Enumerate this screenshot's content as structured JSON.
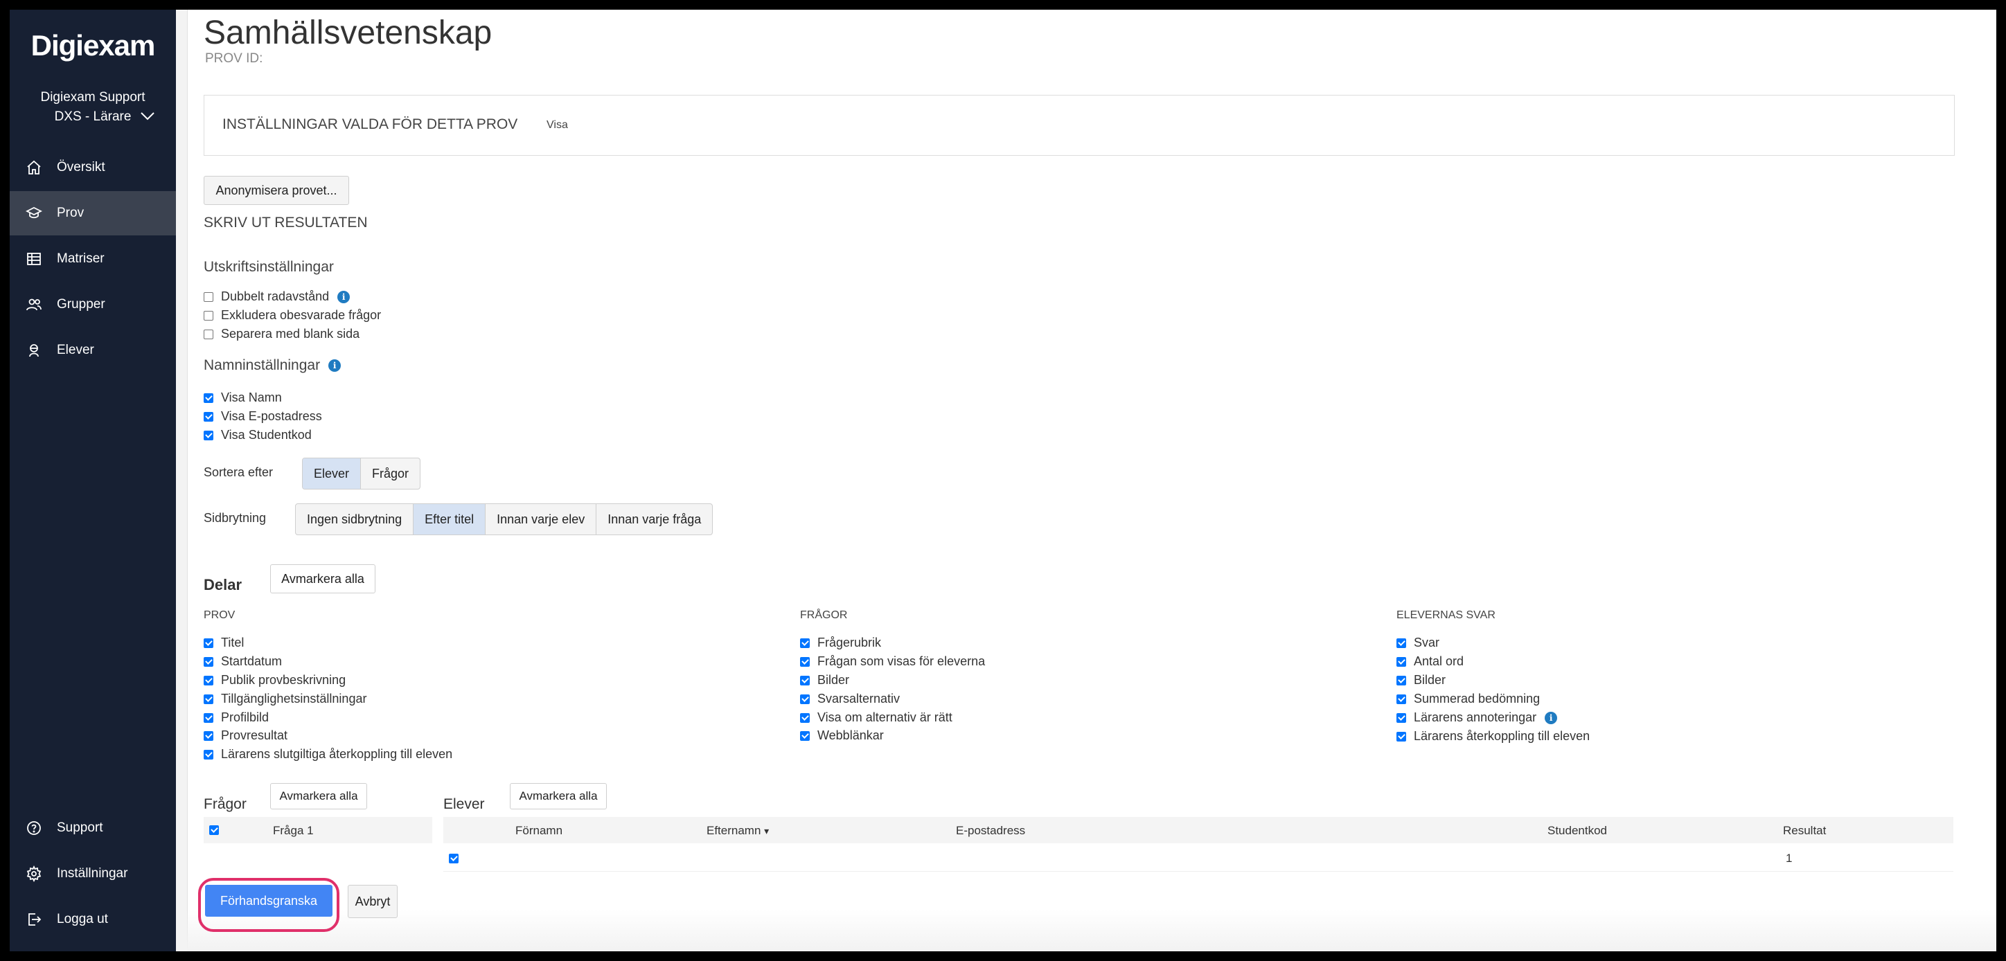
{
  "sidebar": {
    "logo": "Digiexam",
    "org_name": "Digiexam Support",
    "org_role": "DXS - Lärare",
    "nav": [
      {
        "label": "Översikt",
        "icon": "home-icon"
      },
      {
        "label": "Prov",
        "icon": "graduation-cap-icon",
        "active": true
      },
      {
        "label": "Matriser",
        "icon": "table-icon"
      },
      {
        "label": "Grupper",
        "icon": "users-icon"
      },
      {
        "label": "Elever",
        "icon": "student-icon"
      }
    ],
    "bottom_nav": [
      {
        "label": "Support",
        "icon": "help-circle-icon"
      },
      {
        "label": "Inställningar",
        "icon": "gear-icon"
      },
      {
        "label": "Logga ut",
        "icon": "logout-icon"
      }
    ]
  },
  "page": {
    "title": "Samhällsvetenskap",
    "subtitle": "PROV ID:",
    "settings_header": "INSTÄLLNINGAR VALDA FÖR DETTA PROV",
    "settings_link": "Visa",
    "anonymize_button": "Anonymisera provet...",
    "print_results": "SKRIV UT RESULTATEN"
  },
  "print_settings": {
    "heading": "Utskriftsinställningar",
    "options": [
      {
        "label": "Dubbelt radavstånd",
        "checked": false,
        "info": true
      },
      {
        "label": "Exkludera obesvarade frågor",
        "checked": false
      },
      {
        "label": "Separera med blank sida",
        "checked": false
      }
    ]
  },
  "name_settings": {
    "heading": "Namninställningar",
    "options": [
      {
        "label": "Visa Namn",
        "checked": true
      },
      {
        "label": "Visa E-postadress",
        "checked": true
      },
      {
        "label": "Visa Studentkod",
        "checked": true
      }
    ]
  },
  "sort": {
    "label": "Sortera efter",
    "options": [
      "Elever",
      "Frågor"
    ],
    "selected": "Elever"
  },
  "pagebreak": {
    "label": "Sidbrytning",
    "options": [
      "Ingen sidbrytning",
      "Efter titel",
      "Innan varje elev",
      "Innan varje fråga"
    ],
    "selected": "Efter titel"
  },
  "parts": {
    "heading": "Delar",
    "deselect_all": "Avmarkera alla",
    "columns": [
      {
        "heading": "PROV",
        "items": [
          "Titel",
          "Startdatum",
          "Publik provbeskrivning",
          "Tillgänglighetsinställningar",
          "Profilbild",
          "Provresultat",
          "Lärarens slutgiltiga återkoppling till eleven"
        ]
      },
      {
        "heading": "FRÅGOR",
        "items": [
          "Frågerubrik",
          "Frågan som visas för eleverna",
          "Bilder",
          "Svarsalternativ",
          "Visa om alternativ är rätt",
          "Webblänkar"
        ]
      },
      {
        "heading": "ELEVERNAS SVAR",
        "items": [
          "Svar",
          "Antal ord",
          "Bilder",
          "Summerad bedömning",
          "Lärarens annoteringar",
          "Lärarens återkoppling till eleven"
        ]
      }
    ]
  },
  "questions": {
    "heading": "Frågor",
    "deselect_all": "Avmarkera alla",
    "rows": [
      {
        "label": "Fråga 1",
        "checked": true
      }
    ]
  },
  "students": {
    "heading": "Elever",
    "deselect_all": "Avmarkera alla",
    "columns": [
      "Förnamn",
      "Efternamn",
      "E-postadress",
      "Studentkod",
      "Resultat"
    ],
    "sort_indicator": "▾",
    "rows": [
      {
        "checked": true,
        "first_name": "",
        "last_name": "",
        "email": "",
        "student_code": "",
        "result": "1"
      }
    ]
  },
  "footer": {
    "preview_button": "Förhandsgranska",
    "cancel_button": "Avbryt"
  },
  "colors": {
    "sidebar_bg": "#172033",
    "primary": "#4285f4",
    "highlight_ring": "#e0306a",
    "selected_segment": "#d6e2f3"
  }
}
